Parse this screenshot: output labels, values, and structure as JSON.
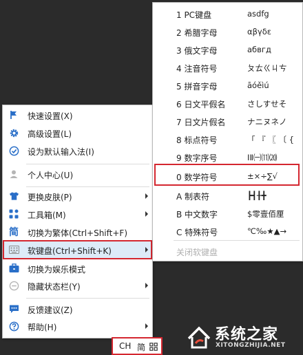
{
  "context_menu": {
    "items": [
      {
        "label": "快速设置(X)",
        "icon": "flag-icon",
        "has_submenu": false
      },
      {
        "label": "高级设置(L)",
        "icon": "gear-icon",
        "has_submenu": false
      },
      {
        "label": "设为默认输入法(I)",
        "icon": "check-circle-icon",
        "has_submenu": false
      },
      {
        "label": "个人中心(U)",
        "icon": "user-icon",
        "has_submenu": false
      },
      {
        "label": "更换皮肤(P)",
        "icon": "shirt-icon",
        "has_submenu": true
      },
      {
        "label": "工具箱(M)",
        "icon": "apps-grid-icon",
        "has_submenu": true
      },
      {
        "label": "切换为繁体(Ctrl+Shift+F)",
        "icon": "jian-char-icon",
        "icon_text": "简",
        "has_submenu": false
      },
      {
        "label": "软键盘(Ctrl+Shift+K)",
        "icon": "keyboard-icon",
        "has_submenu": true
      },
      {
        "label": "切换为娱乐模式",
        "icon": "briefcase-icon",
        "has_submenu": false
      },
      {
        "label": "隐藏状态栏(Y)",
        "icon": "minus-circle-icon",
        "has_submenu": true
      },
      {
        "label": "反馈建议(Z)",
        "icon": "chat-bubble-icon",
        "has_submenu": false
      },
      {
        "label": "帮助(H)",
        "icon": "question-circle-icon",
        "has_submenu": true
      }
    ]
  },
  "keyboard_menu": {
    "items": [
      {
        "label": "1 PC键盘",
        "sample": "asdfg"
      },
      {
        "label": "2 希腊字母",
        "sample": "αβγδε"
      },
      {
        "label": "3 俄文字母",
        "sample": "абвгд"
      },
      {
        "label": "4 注音符号",
        "sample": "ㄆㄊㄍㄐㄘ"
      },
      {
        "label": "5 拼音字母",
        "sample": "āóěìú"
      },
      {
        "label": "6 日文平假名",
        "sample": "さしすせそ"
      },
      {
        "label": "7 日文片假名",
        "sample": "ナニヌネノ"
      },
      {
        "label": "8 标点符号",
        "sample": "「 『 〖 〔 {"
      },
      {
        "label": "9 数字序号",
        "sample": "ⅠⅡ㈠⑾⒇"
      },
      {
        "label": "0 数学符号",
        "sample": "±×÷∑√"
      },
      {
        "label": "A 制表符",
        "sample": "┣┫╂╋"
      },
      {
        "label": "B 中文数字",
        "sample": "$零壹佰厘"
      },
      {
        "label": "C 特殊符号",
        "sample": "℃‰★▲→"
      },
      {
        "label": "关闭软键盘",
        "sample": ""
      }
    ]
  },
  "status_bar": {
    "mode": "CH",
    "variant": "简",
    "icon": "grid-icon"
  },
  "watermark": {
    "title": "系统之家",
    "url": "XITONGZHIJIA.NET"
  },
  "colors": {
    "highlight": "#d4262f",
    "icon_blue": "#2a6fc8",
    "menu_bg": "#ffffff",
    "backdrop": "#2b2b2b"
  }
}
